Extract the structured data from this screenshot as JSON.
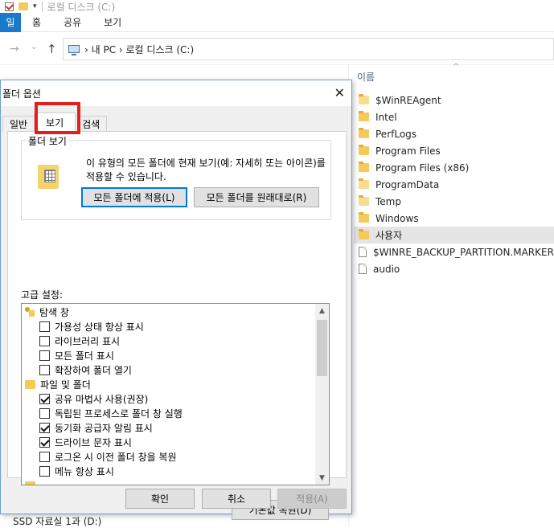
{
  "explorer": {
    "title": "로컬 디스크 (C:)",
    "ribbon_file_tab": "일",
    "ribbon_tabs": [
      "홈",
      "공유",
      "보기"
    ],
    "address_path": "› 내 PC › 로컬 디스크 (C:)",
    "column_header": "이름",
    "sort_caret": "^",
    "left_bottom_item": "SSD 자료실 1과 (D:)",
    "files": [
      {
        "name": "$WinREAgent",
        "icon": "pale-folder-icon"
      },
      {
        "name": "Intel",
        "icon": "folder-icon"
      },
      {
        "name": "PerfLogs",
        "icon": "folder-icon"
      },
      {
        "name": "Program Files",
        "icon": "folder-icon"
      },
      {
        "name": "Program Files (x86)",
        "icon": "folder-icon"
      },
      {
        "name": "ProgramData",
        "icon": "pale-folder-icon"
      },
      {
        "name": "Temp",
        "icon": "pale-folder-icon"
      },
      {
        "name": "Windows",
        "icon": "folder-icon"
      },
      {
        "name": "사용자",
        "icon": "folder-icon",
        "selected": true
      },
      {
        "name": "$WINRE_BACKUP_PARTITION.MARKER",
        "icon": "document-icon"
      },
      {
        "name": "audio",
        "icon": "document-icon"
      }
    ]
  },
  "dialog": {
    "title": "폴더 옵션",
    "close_glyph": "✕",
    "tabs": [
      "일반",
      "보기",
      "검색"
    ],
    "active_tab": "보기",
    "highlight_color": "#e0201b",
    "folder_view": {
      "legend": "폴더 보기",
      "description": "이 유형의 모든 폴더에 현재 보기(예: 자세히 또는 아이콘)를 적용할 수 있습니다.",
      "apply_button": "모든 폴더에 적용(L)",
      "reset_button": "모든 폴더를 원래대로(R)"
    },
    "advanced_label": "고급 설정:",
    "tree": [
      {
        "type": "group",
        "label": "탐색 창",
        "icon": "navigation-pane-icon"
      },
      {
        "type": "check",
        "label": "가용성 상태 항상 표시",
        "checked": false
      },
      {
        "type": "check",
        "label": "라이브러리 표시",
        "checked": false
      },
      {
        "type": "check",
        "label": "모든 폴더 표시",
        "checked": false
      },
      {
        "type": "check",
        "label": "확장하여 폴더 열기",
        "checked": false
      },
      {
        "type": "group",
        "label": "파일 및 폴더",
        "icon": "folder-icon"
      },
      {
        "type": "check",
        "label": "공유 마법사 사용(권장)",
        "checked": true
      },
      {
        "type": "check",
        "label": "독립된 프로세스로 폴더 창 실행",
        "checked": false
      },
      {
        "type": "check",
        "label": "동기화 공급자 알림 표시",
        "checked": true
      },
      {
        "type": "check",
        "label": "드라이브 문자 표시",
        "checked": true
      },
      {
        "type": "check",
        "label": "로그온 시 이전 폴더 창을 복원",
        "checked": false
      },
      {
        "type": "check",
        "label": "메뉴 항상 표시",
        "checked": false
      }
    ],
    "restore_defaults_button": "기본값 복원(D)",
    "ok_button": "확인",
    "cancel_button": "취소",
    "apply_button": "적용(A)"
  }
}
